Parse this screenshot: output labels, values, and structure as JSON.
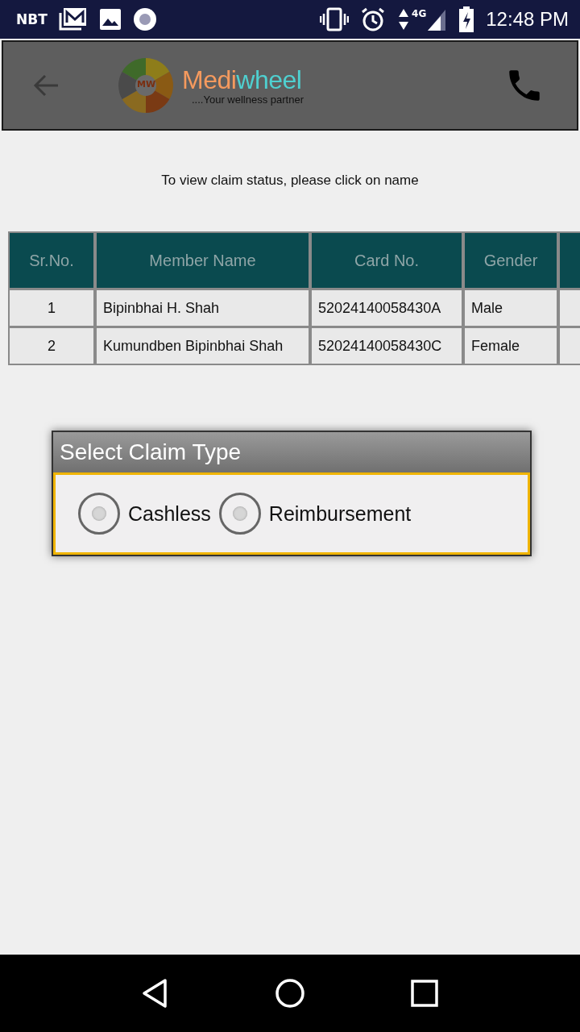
{
  "status_bar": {
    "carrier": "NBT",
    "network": "4G",
    "time": "12:48 PM"
  },
  "header": {
    "brand": {
      "part_1": "Medi",
      "part_2": "wheel",
      "logo_text": "MW",
      "tagline": "....Your wellness partner"
    }
  },
  "instruction": "To view claim status, please click on name",
  "table": {
    "columns": [
      "Sr.No.",
      "Member Name",
      "Card No.",
      "Gender"
    ],
    "rows": [
      {
        "cells": [
          "1",
          "Bipinbhai H. Shah",
          "52024140058430A",
          "Male"
        ]
      },
      {
        "cells": [
          "2",
          "Kumundben Bipinbhai Shah",
          "52024140058430C",
          "Female"
        ]
      }
    ]
  },
  "dialog": {
    "title": "Select Claim Type",
    "options": [
      {
        "label": "Cashless",
        "selected": false
      },
      {
        "label": "Reimbursement",
        "selected": false
      }
    ]
  }
}
